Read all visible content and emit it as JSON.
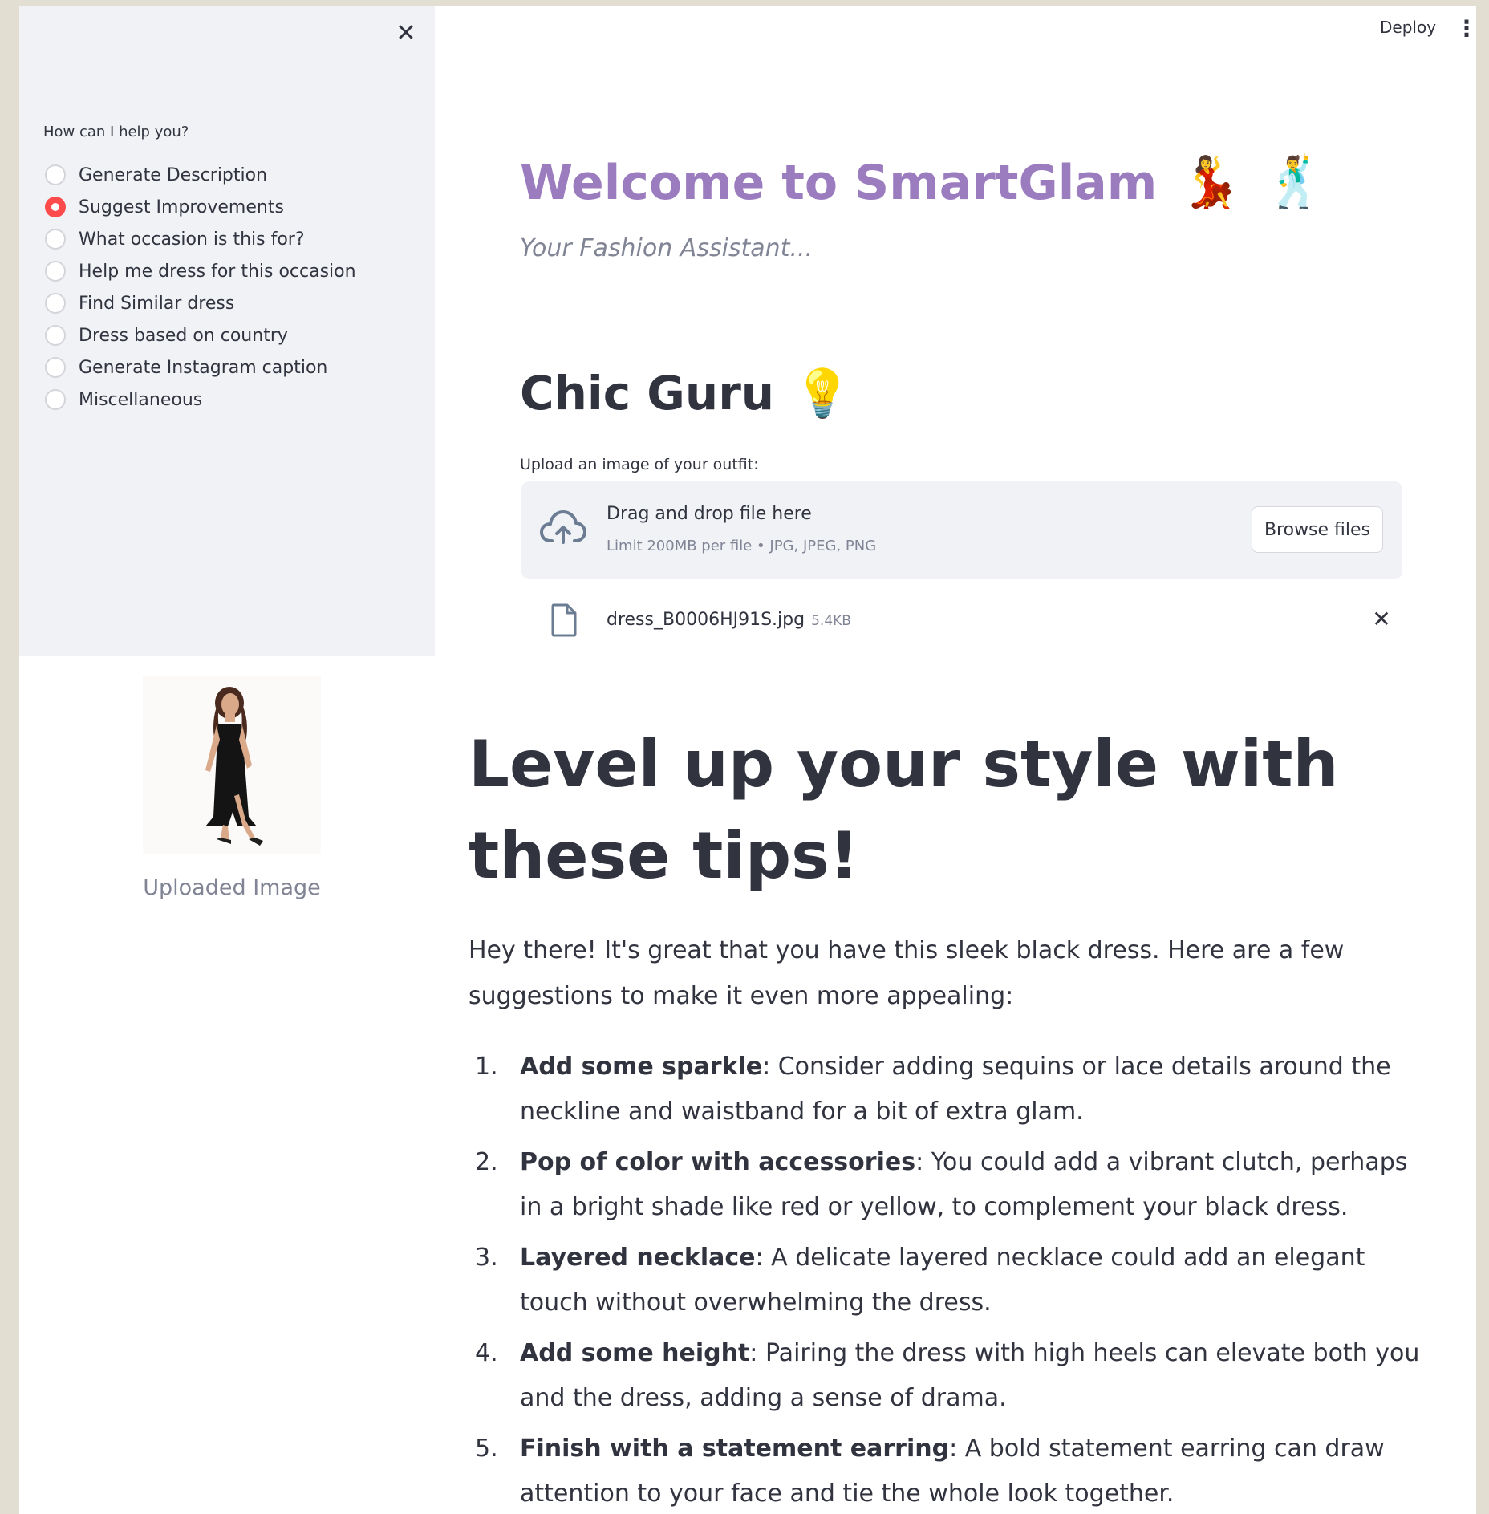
{
  "sidebar": {
    "prompt": "How can I help you?",
    "options": [
      {
        "label": "Generate Description",
        "selected": false
      },
      {
        "label": "Suggest Improvements",
        "selected": true
      },
      {
        "label": "What occasion is this for?",
        "selected": false
      },
      {
        "label": "Help me dress for this occasion",
        "selected": false
      },
      {
        "label": "Find Similar dress",
        "selected": false
      },
      {
        "label": "Dress based on country",
        "selected": false
      },
      {
        "label": "Generate Instagram caption",
        "selected": false
      },
      {
        "label": "Miscellaneous",
        "selected": false
      }
    ]
  },
  "header": {
    "deploy_label": "Deploy"
  },
  "main": {
    "title": "Welcome to SmartGlam",
    "title_emojis": [
      "💃",
      "🕺"
    ],
    "subtitle": "Your Fashion Assistant...",
    "section_title": "Chic Guru",
    "section_emoji": "💡",
    "upload": {
      "label": "Upload an image of your outfit:",
      "drop_title": "Drag and drop file here",
      "limit_text": "Limit 200MB per file • JPG, JPEG, PNG",
      "browse_label": "Browse files",
      "file_name": "dress_B0006HJ91S.jpg",
      "file_size": "5.4KB"
    },
    "image_caption": "Uploaded Image",
    "heading": "Level up your style with these tips!",
    "intro": "Hey there! It's great that you have this sleek black dress. Here are a few suggestions to make it even more appealing:",
    "tips": [
      {
        "num": "1.",
        "title": "Add some sparkle",
        "text": ": Consider adding sequins or lace details around the neckline and waistband for a bit of extra glam."
      },
      {
        "num": "2.",
        "title": "Pop of color with accessories",
        "text": ": You could add a vibrant clutch, perhaps in a bright shade like red or yellow, to complement your black dress."
      },
      {
        "num": "3.",
        "title": "Layered necklace",
        "text": ": A delicate layered necklace could add an elegant touch without overwhelming the dress."
      },
      {
        "num": "4.",
        "title": "Add some height",
        "text": ": Pairing the dress with high heels can elevate both you and the dress, adding a sense of drama."
      },
      {
        "num": "5.",
        "title": "Finish with a statement earring",
        "text": ": A bold statement earring can draw attention to your face and tie the whole look together."
      }
    ]
  },
  "colors": {
    "title": "#9b7cbf",
    "radio_selected": "#ff4b4b",
    "sidebar_bg": "#f0f2f6",
    "text": "#31333f",
    "muted": "#808495"
  }
}
